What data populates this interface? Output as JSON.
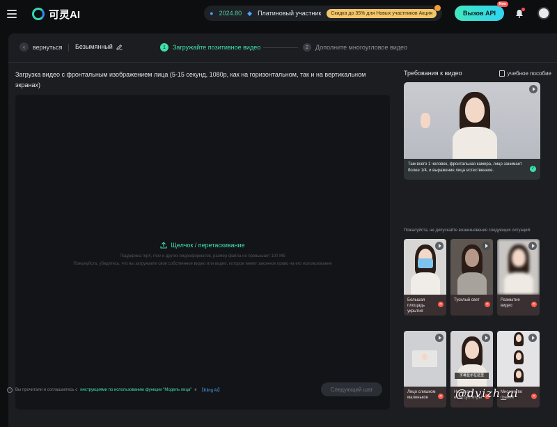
{
  "header": {
    "logo_text": "可灵AI",
    "points": "2024.80",
    "member_label": "Платиновый участник",
    "promo": "Скидка до 35% для Новых участников Акция",
    "api_button": "Вызов API",
    "api_badge": "New"
  },
  "steps": {
    "back_label": "вернуться",
    "title": "Безымянный",
    "step1_number": "1",
    "step1_label": "Загружайте позитивное видео",
    "step2_number": "2",
    "step2_label": "Дополните многоугловое видео"
  },
  "upload": {
    "description": "Загрузка видео с фронтальным изображением лица (5-15 секунд, 1080p, как на горизонтальном, так и на вертикальном экранах)",
    "cta": "Щелчок / перетаскивание",
    "hint_line1": "Поддержка mp4, mov и других видеоформатов, размер файла не превышает 100 МБ",
    "hint_line2": "Пожалуйста, убедитесь, что вы загружаете свое собственное видео или видео, которое имеет законное право на его использование",
    "next_button": "Следующий шаг"
  },
  "footer": {
    "prefix": "Вы прочитали и соглашаетесь с",
    "link": "инструкциями по использованию функции \"Модель лица\"",
    "middle": "в",
    "kling": "【Kling AI】"
  },
  "requirements": {
    "title": "Требования к видео",
    "tutorial": "учебное пособие",
    "good_caption": "Там всего 1 человек, фронтальная камера, лицо занимает более 1/4, и выражение лица естественное.",
    "avoid_title": "Пожалуйста, не допускайте возникновения следующих ситуаций:",
    "bad_items": [
      {
        "label": "Большая площадь укрытия"
      },
      {
        "label": "Тусклый свет"
      },
      {
        "label": "Размытие видео"
      },
      {
        "label": "Лицо слишком маленькое"
      },
      {
        "label": "На экране есть субтитры"
      },
      {
        "label": "Множество граней"
      }
    ],
    "subtitle_sample": "字幕显示在这里"
  },
  "watermark": "@dvizh_ai",
  "colors": {
    "accent": "#3fe0a8",
    "error": "#ff5a4d",
    "background": "#0d0e10",
    "panel": "#1b1d21"
  }
}
